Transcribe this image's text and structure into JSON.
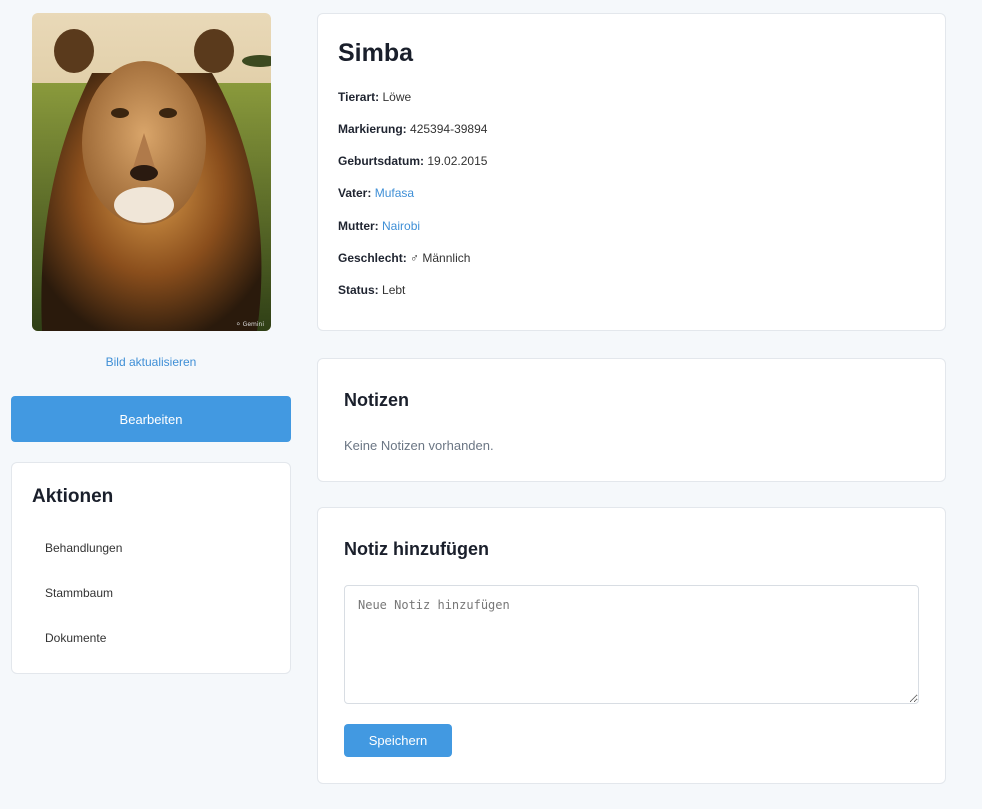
{
  "animal": {
    "name": "Simba",
    "photo_alt": "lion-photo",
    "fields": [
      {
        "label": "Tierart:",
        "value": "Löwe",
        "link": false
      },
      {
        "label": "Markierung:",
        "value": "425394-39894",
        "link": false
      },
      {
        "label": "Geburtsdatum:",
        "value": "19.02.2015",
        "link": false
      },
      {
        "label": "Vater:",
        "value": "Mufasa",
        "link": true
      },
      {
        "label": "Mutter:",
        "value": "Nairobi",
        "link": true
      },
      {
        "label": "Geschlecht:",
        "value": "♂ Männlich",
        "link": false
      },
      {
        "label": "Status:",
        "value": "Lebt",
        "link": false
      }
    ]
  },
  "sidebar": {
    "update_photo_label": "Bild aktualisieren",
    "edit_label": "Bearbeiten",
    "actions_title": "Aktionen",
    "actions": [
      "Behandlungen",
      "Stammbaum",
      "Dokumente"
    ]
  },
  "notes": {
    "title": "Notizen",
    "empty_text": "Keine Notizen vorhanden."
  },
  "add_note": {
    "title": "Notiz hinzufügen",
    "placeholder": "Neue Notiz hinzufügen",
    "value": "",
    "save_label": "Speichern"
  },
  "colors": {
    "accent": "#4299e1",
    "link": "#3f8fd6",
    "background": "#f5f8fb"
  }
}
